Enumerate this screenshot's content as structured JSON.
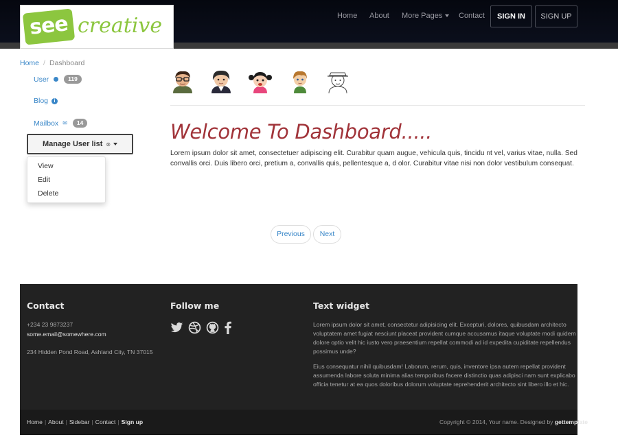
{
  "brand": {
    "logo_text": "seecreative"
  },
  "nav": {
    "home": "Home",
    "about": "About",
    "more_pages": "More Pages",
    "contact": "Contact",
    "sign_in": "SIGN IN",
    "sign_up": "SIGN UP"
  },
  "breadcrumb": {
    "home": "Home",
    "current": "Dashboard"
  },
  "sidebar": {
    "user": {
      "label": "User",
      "badge": "119"
    },
    "blog": {
      "label": "Blog",
      "info": "i"
    },
    "mailbox": {
      "label": "Mailbox",
      "badge": "14"
    },
    "manage_button": "Manage User list",
    "dropdown": [
      "View",
      "Edit",
      "Delete"
    ]
  },
  "avatars": [
    "avatar-glasses",
    "avatar-man",
    "avatar-girl",
    "avatar-boy",
    "avatar-sketch"
  ],
  "main": {
    "title": "Welcome To Dashboard.....",
    "body": "Lorem ipsum dolor sit amet, consectetuer adipiscing elit. Curabitur quam augue, vehicula quis, tincidu nt vel, varius vitae, nulla. Sed convallis orci. Duis libero orci, pretium a, convallis quis, pellentesque a, d olor. Curabitur vitae nisi non dolor vestibulum consequat."
  },
  "pager": {
    "previous": "Previous",
    "next": "Next"
  },
  "footer": {
    "contact": {
      "heading": "Contact",
      "phone": "+234 23 9873237",
      "email": "some.email@somewhere.com",
      "address": "234 Hidden Pond Road, Ashland City, TN 37015"
    },
    "follow": {
      "heading": "Follow me",
      "icons": [
        "twitter-icon",
        "dribbble-icon",
        "github-icon",
        "facebook-icon"
      ]
    },
    "widget": {
      "heading": "Text widget",
      "p1_lines": [
        "Lorem ipsum dolor sit amet, consectetur adipisicing elit. Excepturi, dolores, quibusdam architecto",
        "voluptatem amet fugiat nesciunt placeat provident cumque accusamus itaque voluptate modi quidem",
        "dolore optio velit hic iusto vero praesentium repellat commodi ad id expedita cupiditate repellendus",
        "possimus unde?"
      ],
      "p2_lines": [
        "Eius consequatur nihil quibusdam! Laborum, rerum, quis, inventore ipsa autem repellat provident",
        "assumenda labore soluta minima alias temporibus facere distinctio quas adipisci nam sunt explicabo",
        "officia tenetur at ea quos doloribus dolorum voluptate reprehenderit architecto sint libero illo et hic."
      ]
    },
    "links": [
      "Home",
      "About",
      "Sidebar",
      "Contact",
      "Sign up"
    ],
    "copyright_prefix": "Copyright © 2014, Your name. Designed by ",
    "copyright_brand": "gettemplate"
  },
  "colors": {
    "accent": "#3a87c8",
    "title": "#a1343a",
    "brand_green": "#8cc63f"
  }
}
